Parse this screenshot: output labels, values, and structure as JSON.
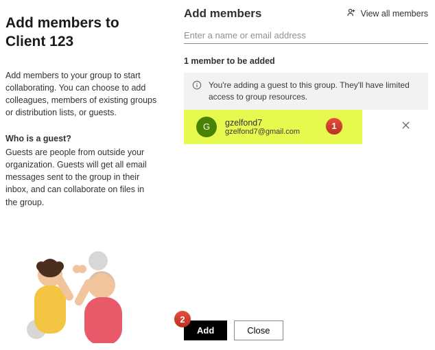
{
  "left": {
    "title": "Add members to Client 123",
    "desc": "Add members to your group to start collaborating. You can choose to add colleagues, members of existing groups or distribution lists, or guests.",
    "subhead": "Who is a guest?",
    "subdesc": "Guests are people from outside your organization. Guests will get all email messages sent to the group in their inbox, and can collaborate on files in the group."
  },
  "header": {
    "title": "Add members",
    "view_all": "View all members"
  },
  "input": {
    "placeholder": "Enter a name or email address"
  },
  "count_line": "1 member to be added",
  "info_text": "You're adding a guest to this group. They'll have limited access to group resources.",
  "member": {
    "initial": "G",
    "name": "gzelfond7",
    "email": "gzelfond7@gmail.com"
  },
  "callouts": {
    "one": "1",
    "two": "2"
  },
  "buttons": {
    "add": "Add",
    "close": "Close"
  }
}
